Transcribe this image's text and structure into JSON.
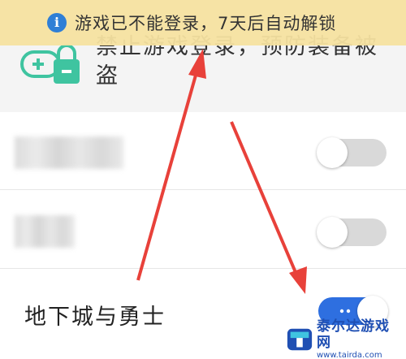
{
  "toast": {
    "icon": "info-icon",
    "message": "游戏已不能登录，7天后自动解锁"
  },
  "lock_card": {
    "icon": "lock-add-icon",
    "description": "禁止游戏登录，预防装备被盗"
  },
  "rows": [
    {
      "label_blurred": true,
      "switch_on": false
    },
    {
      "label_blurred": true,
      "switch_on": false
    },
    {
      "label": "地下城与勇士",
      "switch_on": true
    }
  ],
  "colors": {
    "accent": "#2e6fe0",
    "toast_bg": "#f6e2a0",
    "lock_green": "#3fc4a0",
    "arrow_red": "#e8413a",
    "switch_off": "#d9d9d9"
  },
  "watermark": {
    "name": "泰尔达游戏网",
    "url": "www.tairda.com"
  }
}
